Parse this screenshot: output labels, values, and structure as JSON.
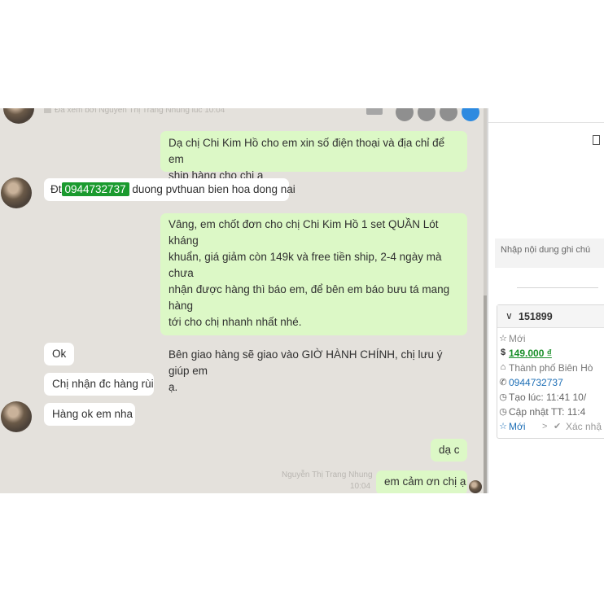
{
  "chat": {
    "seen_text": "Đã xem bởi Nguyễn Thị Trang Nhung lúc 10:04",
    "messages": {
      "m1_line1": "Dạ chị Chi Kim Hồ cho em xin số điện thoại và địa chỉ để em",
      "m1_line2": "ship hàng cho chị ạ",
      "m2_prefix": "Đt",
      "m2_phone": "0944732737",
      "m2_rest": "duong pvthuan bien hoa dong nai",
      "m3_line1": "Vâng, em chốt đơn cho chị Chi Kim Hồ 1 set QUẦN Lót kháng",
      "m3_line2": "khuẩn, giá giảm còn 149k và free tiền ship, 2-4 ngày mà chưa",
      "m3_line3": "nhận được hàng thì báo em, để bên em báo bưu tá mang hàng",
      "m3_line4": "tới cho chị nhanh nhất nhé.",
      "m3_line5": "Bên giao hàng sẽ giao vào GIỜ HÀNH CHÍNH, chị lưu ý giúp em",
      "m3_line6": "ạ.",
      "m4": "Ok",
      "m5": "Chị nhận đc hàng rùi",
      "m6": "Hàng ok em nha",
      "m7": "dạ c",
      "m8": "em cảm ơn chị ạ"
    },
    "sender_name": "Nguyễn Thị Trang Nhung",
    "sender_time": "10:04"
  },
  "panel": {
    "note_placeholder": "Nhập nội dung ghi chú",
    "order_id": "151899",
    "status": "Mới",
    "price": "149.000 ₫",
    "city": "Thành phố Biên Hò",
    "phone": "0944732737",
    "created": "Tạo lúc: 11:41 10/",
    "updated": "Cập nhật TT: 11:4",
    "step_current": "Mới",
    "step_next": "Xác nhậ",
    "chevron": ">",
    "colors": {
      "link_blue": "#1e6fb6",
      "price_green": "#1a8f2a",
      "bubble_out": "#dcf8c6",
      "phone_pill": "#1a9a2e"
    }
  }
}
